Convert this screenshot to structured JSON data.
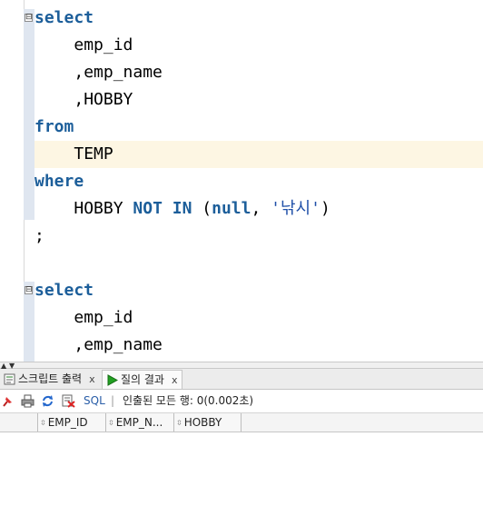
{
  "editor": {
    "block1": {
      "select": "select",
      "col1": "emp_id",
      "col2": ",emp_name",
      "col3": ",HOBBY",
      "from": "from",
      "table": "TEMP",
      "where": "where",
      "cond_field": "HOBBY",
      "not_in": "NOT IN",
      "open_paren": "(",
      "null_kw": "null",
      "comma": ", ",
      "str_literal": "'낚시'",
      "close_paren": ")",
      "terminator": ";"
    },
    "block2": {
      "select": "select",
      "col1": "emp_id",
      "col2": ",emp_name"
    },
    "fold_marker": "⊟"
  },
  "bottom_panel": {
    "tabs": [
      {
        "label": "스크립트 출력",
        "close": "x"
      },
      {
        "label": "질의 결과",
        "close": "x"
      }
    ],
    "toolbar": {
      "sql_label": "SQL",
      "separator": "|",
      "status": "인출된 모든 행: 0(0.002초)"
    },
    "columns": [
      "EMP_ID",
      "EMP_N...",
      "HOBBY"
    ]
  },
  "colors": {
    "keyword": "#1c5e9a",
    "highlight_line": "#fdf6e3"
  }
}
